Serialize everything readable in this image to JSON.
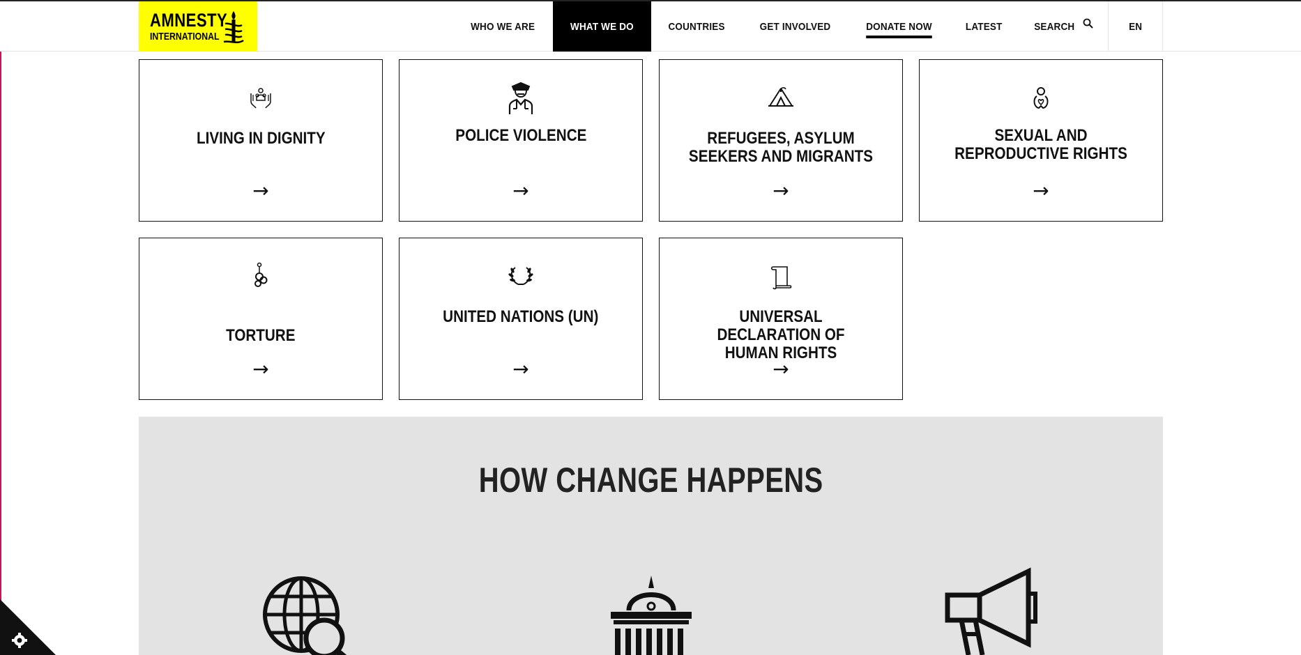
{
  "brand": {
    "line1": "AMNESTY",
    "line2": "INTERNATIONAL",
    "color": "#ffff00"
  },
  "nav": {
    "items": [
      {
        "label": "WHO WE ARE"
      },
      {
        "label": "WHAT WE DO"
      },
      {
        "label": "COUNTRIES"
      },
      {
        "label": "GET INVOLVED"
      },
      {
        "label": "DONATE NOW"
      },
      {
        "label": "LATEST"
      }
    ],
    "search_label": "SEARCH",
    "language": "EN"
  },
  "topics": [
    {
      "title": "LIVING IN DIGNITY",
      "icon": "hands-family-icon",
      "arrow": "→"
    },
    {
      "title": "POLICE VIOLENCE",
      "icon": "police-officer-icon",
      "arrow": "→"
    },
    {
      "title": "REFUGEES, ASYLUM SEEKERS AND MIGRANTS",
      "icon": "tent-icon",
      "arrow": "→"
    },
    {
      "title": "SEXUAL AND REPRODUCTIVE RIGHTS",
      "icon": "person-heart-icon",
      "arrow": "→"
    },
    {
      "title": "TORTURE",
      "icon": "chain-handcuff-icon",
      "arrow": "→"
    },
    {
      "title": "UNITED NATIONS (UN)",
      "icon": "laurel-wreath-icon",
      "arrow": "→"
    },
    {
      "title": "UNIVERSAL DECLARATION OF HUMAN RIGHTS",
      "icon": "scroll-icon",
      "arrow": "→"
    }
  ],
  "how_change": {
    "title": "HOW CHANGE HAPPENS",
    "icons": [
      "globe-magnifier-icon",
      "government-building-icon",
      "megaphone-icon"
    ]
  }
}
